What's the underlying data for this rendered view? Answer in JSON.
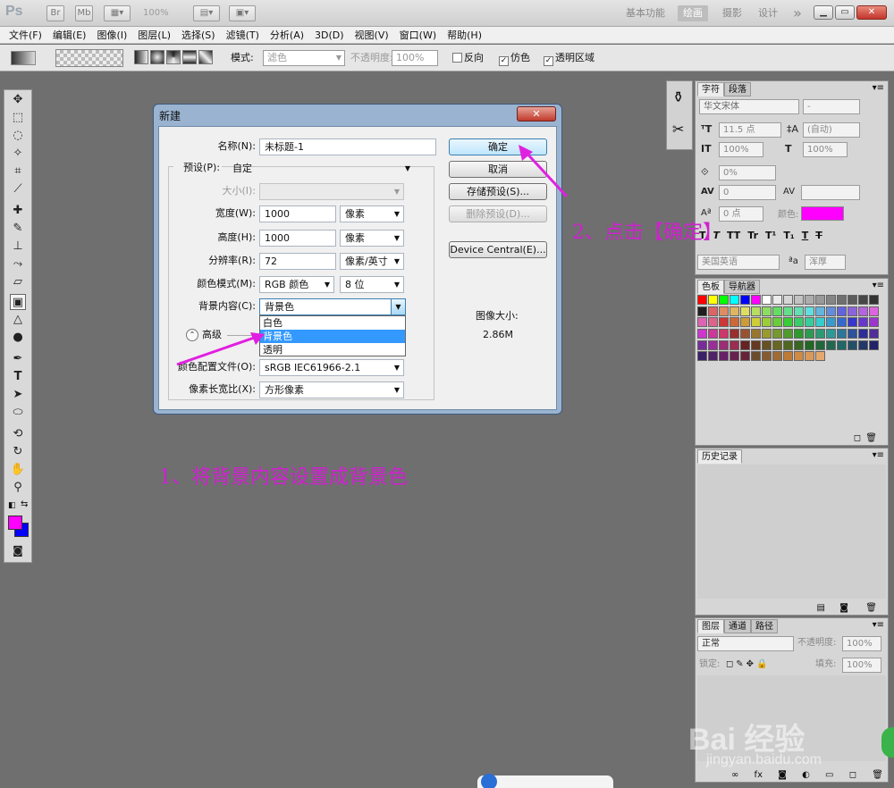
{
  "titlebar": {
    "app_logo": "Ps",
    "br_label": "Br",
    "mb_label": "Mb",
    "zoom": "100%",
    "workspaces": [
      "基本功能",
      "绘画",
      "摄影",
      "设计"
    ],
    "more": "»"
  },
  "menubar": {
    "items": [
      "文件(F)",
      "编辑(E)",
      "图像(I)",
      "图层(L)",
      "选择(S)",
      "滤镜(T)",
      "分析(A)",
      "3D(D)",
      "视图(V)",
      "窗口(W)",
      "帮助(H)"
    ]
  },
  "options": {
    "mode_label": "模式:",
    "mode_value": "滤色",
    "opacity_label": "不透明度:",
    "opacity_value": "100%",
    "reverse_label": "反向",
    "dither_label": "仿色",
    "transparency_label": "透明区域"
  },
  "dialog": {
    "title": "新建",
    "name_label": "名称(N):",
    "name_value": "未标题-1",
    "preset_label": "预设(P):",
    "preset_value": "自定",
    "size_label": "大小(I):",
    "width_label": "宽度(W):",
    "width_value": "1000",
    "width_unit": "像素",
    "height_label": "高度(H):",
    "height_value": "1000",
    "height_unit": "像素",
    "resolution_label": "分辨率(R):",
    "resolution_value": "72",
    "resolution_unit": "像素/英寸",
    "color_mode_label": "颜色模式(M):",
    "color_mode_value": "RGB 颜色",
    "bit_depth": "8 位",
    "bg_label": "背景内容(C):",
    "bg_value": "背景色",
    "bg_options": [
      "白色",
      "背景色",
      "透明"
    ],
    "advanced_label": "高级",
    "profile_label": "颜色配置文件(O):",
    "profile_value": "sRGB IEC61966-2.1",
    "pixel_aspect_label": "像素长宽比(X):",
    "pixel_aspect_value": "方形像素",
    "ok_label": "确定",
    "cancel_label": "取消",
    "save_preset_label": "存储预设(S)...",
    "delete_preset_label": "删除预设(D)...",
    "device_central_label": "Device Central(E)...",
    "image_size_label": "图像大小:",
    "image_size_value": "2.86M"
  },
  "annotations": {
    "step1": "1、将背景内容设置成背景色",
    "step2": "2、点击【确定】"
  },
  "char_panel": {
    "tabs": [
      "字符",
      "段落"
    ],
    "font": "华文宋体",
    "style": "-",
    "size": "11.5 点",
    "leading": "(自动)",
    "vscale": "100%",
    "hscale": "100%",
    "baseline": "0%",
    "tracking": "0",
    "kerning_shift": "0 点",
    "color_label": "颜色:",
    "language": "美国英语",
    "aa_label": "a",
    "antialias": "浑厚",
    "type_buttons": [
      "T",
      "T",
      "TT",
      "Tr",
      "T¹",
      "T₁",
      "T",
      "T"
    ]
  },
  "swatch_panel": {
    "tabs": [
      "色板",
      "导航器"
    ]
  },
  "history_panel": {
    "tabs": [
      "历史记录"
    ]
  },
  "layers_panel": {
    "tabs": [
      "图层",
      "通道",
      "路径"
    ],
    "blend_mode": "正常",
    "opacity_label": "不透明度:",
    "opacity_value": "100%",
    "lock_label": "锁定:",
    "fill_label": "填充:",
    "fill_value": "100%"
  },
  "watermark": {
    "brand": "Bai 经验",
    "url": "jingyan.baidu.com"
  },
  "colors": {
    "foreground": "#ff00ff",
    "background": "#0000ff",
    "annotation": "#d020d0",
    "char_color": "#ff00ff"
  }
}
